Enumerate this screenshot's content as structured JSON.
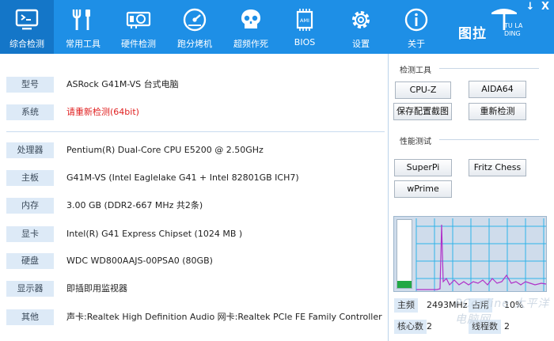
{
  "toolbar": {
    "tabs": [
      {
        "label": "综合检测",
        "icon": "monitor-icon",
        "active": true
      },
      {
        "label": "常用工具",
        "icon": "tools-icon",
        "active": false
      },
      {
        "label": "硬件检测",
        "icon": "gpu-card-icon",
        "active": false
      },
      {
        "label": "跑分烤机",
        "icon": "gauge-icon",
        "active": false
      },
      {
        "label": "超频作死",
        "icon": "skull-icon",
        "active": false
      },
      {
        "label": "BIOS",
        "icon": "bios-chip-icon",
        "active": false
      },
      {
        "label": "设置",
        "icon": "gear-icon",
        "active": false
      },
      {
        "label": "关于",
        "icon": "info-icon",
        "active": false
      }
    ],
    "brand": {
      "name": "图拉",
      "sub": "TU LA DING"
    },
    "minimize": "↓",
    "close": "X"
  },
  "info": {
    "top_rows": [
      {
        "key": "型号",
        "value": "ASRock G41M-VS 台式电脑"
      },
      {
        "key": "系统",
        "value": "请重新检测(64bit)",
        "alert": true
      }
    ],
    "rows": [
      {
        "key": "处理器",
        "value": "Pentium(R) Dual-Core  CPU      E5200  @ 2.50GHz"
      },
      {
        "key": "主板",
        "value": "G41M-VS (Intel Eaglelake G41 + Intel 82801GB ICH7)"
      },
      {
        "key": "内存",
        "value": "3.00 GB (DDR2-667 MHz 共2条)"
      },
      {
        "key": "显卡",
        "value": "Intel(R) G41 Express Chipset (1024 MB  )"
      },
      {
        "key": "硬盘",
        "value": "WDC WD800AAJS-00PSA0 (80GB)"
      },
      {
        "key": "显示器",
        "value": "即插即用监视器"
      },
      {
        "key": "其他",
        "value": "声卡:Realtek High Definition Audio 网卡:Realtek PCIe FE Family Controller"
      }
    ]
  },
  "tools": {
    "title": "检测工具",
    "buttons": [
      "CPU-Z",
      "AIDA64",
      "保存配置截图",
      "重新检测"
    ]
  },
  "bench": {
    "title": "性能测试",
    "buttons": [
      "SuperPi",
      "Fritz Chess",
      "wPrime"
    ]
  },
  "monitor": {
    "usage_fraction": 0.1,
    "colors": {
      "usage_bar": "#22a845",
      "grid": "#2fb3e8",
      "trace": "#b030c8"
    }
  },
  "stats": {
    "freq_key": "主频",
    "freq_value": "2493MHz",
    "usage_key": "占用",
    "usage_value": "10%",
    "cores_key": "核心数",
    "cores_value": "2",
    "threads_key": "线程数",
    "threads_value": "2"
  },
  "watermark": "PConline 太平洋电脑网",
  "colors": {
    "accent": "#1e8fe6",
    "active_tab": "#1476c8",
    "label_bg": "#ddeaf7",
    "alert": "#e02020"
  }
}
